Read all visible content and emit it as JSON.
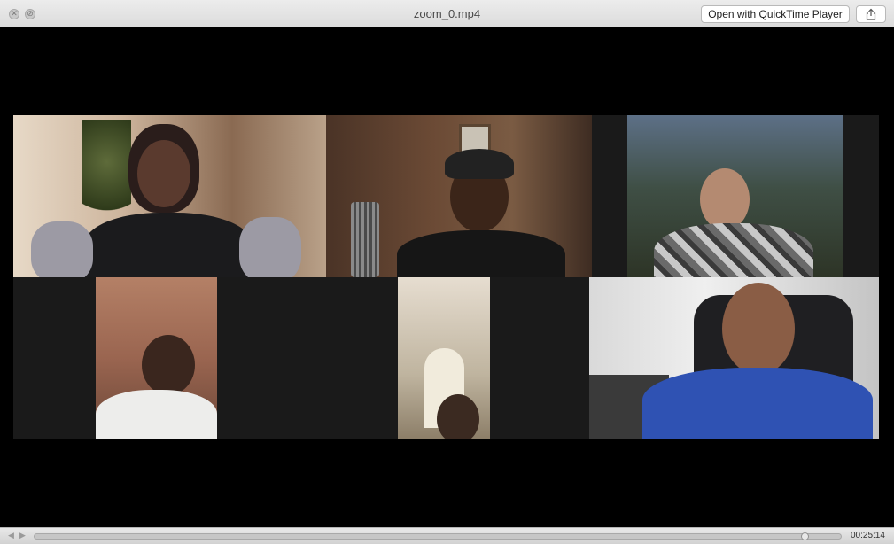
{
  "window": {
    "title": "zoom_0.mp4",
    "open_with_label": "Open with QuickTime Player",
    "close_glyph": "✕",
    "minimize_glyph": "⊘"
  },
  "icons": {
    "close": "close-icon",
    "disabled": "disabled-icon",
    "share": "share-icon",
    "rewind": "rewind-icon",
    "forward": "forward-icon"
  },
  "player": {
    "timecode": "00:25:14",
    "progress": 0.96
  },
  "colors": {
    "letterbox": "#000000",
    "tile_background": "#1a1a1a",
    "titlebar": "#e4e4e4",
    "controlbar": "#dcdcdc"
  },
  "participants": [
    {
      "id": "p1",
      "shirt": "black and gray"
    },
    {
      "id": "p2",
      "shirt": "black, cap"
    },
    {
      "id": "p3",
      "shirt": "camouflage hoodie"
    },
    {
      "id": "p4",
      "shirt": "white sweater"
    },
    {
      "id": "p5",
      "shirt": "dark"
    },
    {
      "id": "p6",
      "shirt": "blue"
    }
  ]
}
